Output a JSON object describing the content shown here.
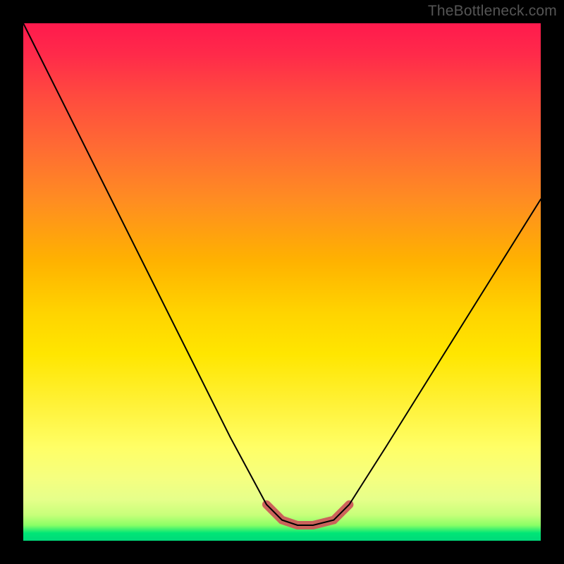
{
  "watermark": "TheBottleneck.com",
  "chart_data": {
    "type": "line",
    "title": "",
    "xlabel": "",
    "ylabel": "",
    "xlim": [
      0,
      1
    ],
    "ylim": [
      0,
      1
    ],
    "series": [
      {
        "name": "bottleneck-curve",
        "x": [
          0.0,
          0.1,
          0.2,
          0.3,
          0.4,
          0.47,
          0.5,
          0.53,
          0.56,
          0.6,
          0.63,
          0.7,
          0.8,
          0.9,
          1.0
        ],
        "y": [
          1.0,
          0.8,
          0.6,
          0.4,
          0.2,
          0.07,
          0.04,
          0.03,
          0.03,
          0.04,
          0.07,
          0.18,
          0.34,
          0.5,
          0.66
        ]
      },
      {
        "name": "highlight-segment",
        "x": [
          0.47,
          0.5,
          0.53,
          0.56,
          0.6,
          0.63
        ],
        "y": [
          0.07,
          0.04,
          0.03,
          0.03,
          0.04,
          0.07
        ]
      }
    ],
    "colors": {
      "top": "#ff1a4d",
      "mid": "#ffd400",
      "bottom": "#00d97a",
      "line": "#000000",
      "highlight": "#cc5a5a"
    }
  }
}
